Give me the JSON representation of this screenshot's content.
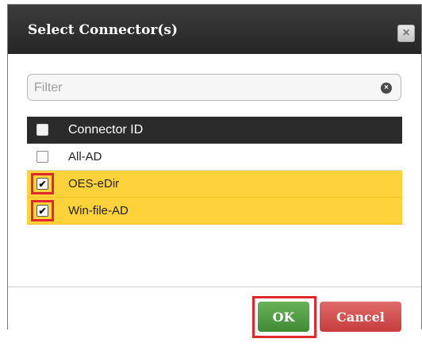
{
  "dialog": {
    "title": "Select Connector(s)",
    "close_icon": "×"
  },
  "filter": {
    "placeholder": "Filter",
    "value": "",
    "clear_icon": "×"
  },
  "table": {
    "header": {
      "label": "Connector ID",
      "checked": false
    },
    "rows": [
      {
        "label": "All-AD",
        "checked": false,
        "selected": false
      },
      {
        "label": "OES-eDir",
        "checked": true,
        "selected": true
      },
      {
        "label": "Win-file-AD",
        "checked": true,
        "selected": true
      }
    ],
    "check_mark": "✔"
  },
  "buttons": {
    "ok_label": "OK",
    "cancel_label": "Cancel"
  },
  "colors": {
    "title_bar": "#2f2f2f",
    "selected_row": "#fdd23a",
    "highlight": "#e0282f",
    "ok_button": "#4f9b42",
    "cancel_button": "#d04848"
  }
}
